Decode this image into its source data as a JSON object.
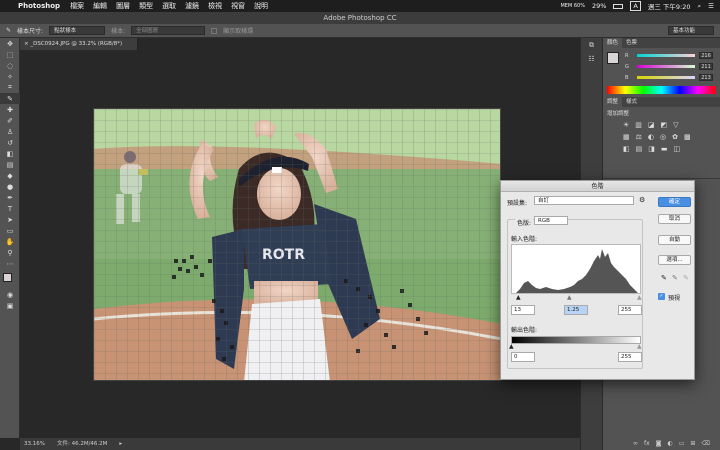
{
  "menubar": {
    "app": "Photoshop",
    "items": [
      "檔案",
      "編輯",
      "圖層",
      "類型",
      "選取",
      "濾鏡",
      "檢視",
      "視窗",
      "說明"
    ],
    "status": {
      "mem": "MEM 60%",
      "battery": "29%",
      "input": "A",
      "clock": "週三 下午9:20"
    }
  },
  "window": {
    "title": "Adobe Photoshop CC"
  },
  "options": {
    "size_label": "樣本尺寸:",
    "size_value": "點狀樣本",
    "sample_label": "樣本:",
    "sample_value": "全部圖層",
    "ring_label": "顯示取樣環",
    "workspace": "基本功能"
  },
  "document": {
    "tab": "_DSC0924.JPG @ 33.2% (RGB/8*)",
    "zoom": "33.16%",
    "file_info": "文件: 46.2M/46.2M"
  },
  "panels": {
    "color_tabs": [
      "顏色",
      "色票"
    ],
    "r_value": "216",
    "g_value": "211",
    "b_value": "213",
    "adj_tabs": [
      "調整",
      "樣式"
    ],
    "adj_title": "增加調整"
  },
  "levels": {
    "title": "色階",
    "preset_label": "預設集:",
    "preset_value": "自訂",
    "channel_label": "色版:",
    "channel_value": "RGB",
    "input_label": "輸入色階:",
    "in_black": "13",
    "in_gamma": "1.25",
    "in_white": "255",
    "output_label": "輸出色階:",
    "out_black": "0",
    "out_white": "255",
    "ok": "確定",
    "cancel": "取消",
    "auto": "自動",
    "options": "選項...",
    "preview": "預視"
  }
}
